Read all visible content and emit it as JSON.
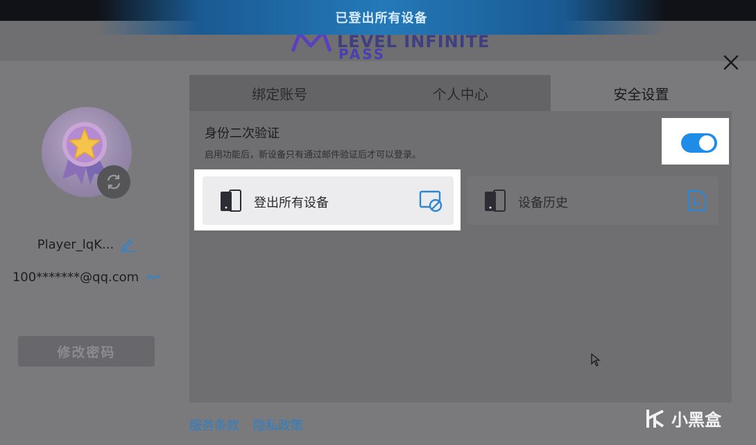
{
  "toast": {
    "text": "已登出所有设备"
  },
  "logo": {
    "line1": "LEVEL INFINITE",
    "line2": "PASS"
  },
  "profile": {
    "username": "Player_lqK...",
    "email": "100*******@qq.com",
    "change_password_label": "修改密码"
  },
  "tabs": [
    {
      "label": "绑定账号",
      "active": false
    },
    {
      "label": "个人中心",
      "active": false
    },
    {
      "label": "安全设置",
      "active": true
    }
  ],
  "security": {
    "two_factor_title": "身份二次验证",
    "two_factor_desc": "启用功能后，新设备只有通过邮件验证后才可以登录。",
    "two_factor_enabled": true,
    "logout_all_label": "登出所有设备",
    "device_history_label": "设备历史"
  },
  "footer": {
    "terms_label": "服务条款",
    "privacy_label": "隐私政策"
  },
  "watermark": {
    "text": "小黑盒"
  },
  "colors": {
    "accent": "#1f8ce8",
    "toast_bg": "#2479b8",
    "link": "#2e7fc4"
  }
}
